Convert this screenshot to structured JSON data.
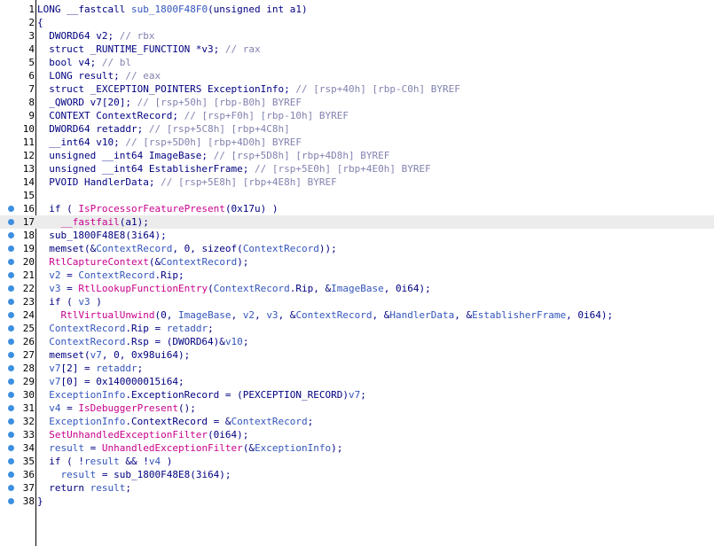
{
  "colors": {
    "background": "#ffffff",
    "keyword_text": "#000080",
    "api_call": "#c8008c",
    "variable": "#3355bb",
    "comment": "#8282b0",
    "line_number": "#000000",
    "breakpoint_dot": "#3d8fe0",
    "current_line_highlight": "#ececec"
  },
  "code_lines": [
    {
      "num": "1",
      "bp": false,
      "hl": false,
      "parts": [
        [
          "",
          "LONG __fastcall "
        ],
        [
          "uf",
          "sub_1800F48F0"
        ],
        [
          "",
          "(unsigned int a1)"
        ]
      ]
    },
    {
      "num": "2",
      "bp": false,
      "hl": false,
      "parts": [
        [
          "",
          "{"
        ]
      ]
    },
    {
      "num": "3",
      "bp": false,
      "hl": false,
      "parts": [
        [
          "",
          "  DWORD64 v2; "
        ],
        [
          "cmt",
          "// rbx"
        ]
      ]
    },
    {
      "num": "4",
      "bp": false,
      "hl": false,
      "parts": [
        [
          "",
          "  struct _RUNTIME_FUNCTION *v3; "
        ],
        [
          "cmt",
          "// rax"
        ]
      ]
    },
    {
      "num": "5",
      "bp": false,
      "hl": false,
      "parts": [
        [
          "",
          "  bool v4; "
        ],
        [
          "cmt",
          "// bl"
        ]
      ]
    },
    {
      "num": "6",
      "bp": false,
      "hl": false,
      "parts": [
        [
          "",
          "  LONG result; "
        ],
        [
          "cmt",
          "// eax"
        ]
      ]
    },
    {
      "num": "7",
      "bp": false,
      "hl": false,
      "parts": [
        [
          "",
          "  struct _EXCEPTION_POINTERS ExceptionInfo; "
        ],
        [
          "cmt",
          "// [rsp+40h] [rbp-C0h] BYREF"
        ]
      ]
    },
    {
      "num": "8",
      "bp": false,
      "hl": false,
      "parts": [
        [
          "",
          "  _QWORD v7[20]; "
        ],
        [
          "cmt",
          "// [rsp+50h] [rbp-B0h] BYREF"
        ]
      ]
    },
    {
      "num": "9",
      "bp": false,
      "hl": false,
      "parts": [
        [
          "",
          "  CONTEXT ContextRecord; "
        ],
        [
          "cmt",
          "// [rsp+F0h] [rbp-10h] BYREF"
        ]
      ]
    },
    {
      "num": "10",
      "bp": false,
      "hl": false,
      "parts": [
        [
          "",
          "  DWORD64 retaddr; "
        ],
        [
          "cmt",
          "// [rsp+5C8h] [rbp+4C8h]"
        ]
      ]
    },
    {
      "num": "11",
      "bp": false,
      "hl": false,
      "parts": [
        [
          "",
          "  __int64 v10; "
        ],
        [
          "cmt",
          "// [rsp+5D0h] [rbp+4D0h] BYREF"
        ]
      ]
    },
    {
      "num": "12",
      "bp": false,
      "hl": false,
      "parts": [
        [
          "",
          "  unsigned __int64 ImageBase; "
        ],
        [
          "cmt",
          "// [rsp+5D8h] [rbp+4D8h] BYREF"
        ]
      ]
    },
    {
      "num": "13",
      "bp": false,
      "hl": false,
      "parts": [
        [
          "",
          "  unsigned __int64 EstablisherFrame; "
        ],
        [
          "cmt",
          "// [rsp+5E0h] [rbp+4E0h] BYREF"
        ]
      ]
    },
    {
      "num": "14",
      "bp": false,
      "hl": false,
      "parts": [
        [
          "",
          "  PVOID HandlerData; "
        ],
        [
          "cmt",
          "// [rsp+5E8h] [rbp+4E8h] BYREF"
        ]
      ]
    },
    {
      "num": "15",
      "bp": false,
      "hl": false,
      "parts": [
        [
          "",
          ""
        ]
      ]
    },
    {
      "num": "16",
      "bp": true,
      "hl": false,
      "parts": [
        [
          "",
          "  if ( "
        ],
        [
          "api",
          "IsProcessorFeaturePresent"
        ],
        [
          "",
          "(0x17u) )"
        ]
      ]
    },
    {
      "num": "17",
      "bp": true,
      "hl": true,
      "parts": [
        [
          "",
          "    "
        ],
        [
          "api",
          "__fastfail"
        ],
        [
          "",
          "(a1);"
        ]
      ]
    },
    {
      "num": "18",
      "bp": true,
      "hl": false,
      "parts": [
        [
          "",
          "  sub_1800F48E8(3i64);"
        ]
      ]
    },
    {
      "num": "19",
      "bp": true,
      "hl": false,
      "parts": [
        [
          "",
          "  memset(&"
        ],
        [
          "var",
          "ContextRecord"
        ],
        [
          "",
          ", 0, sizeof("
        ],
        [
          "var",
          "ContextRecord"
        ],
        [
          "",
          "));"
        ]
      ]
    },
    {
      "num": "20",
      "bp": true,
      "hl": false,
      "parts": [
        [
          "api",
          "  RtlCaptureContext"
        ],
        [
          "",
          "(&"
        ],
        [
          "var",
          "ContextRecord"
        ],
        [
          "",
          ");"
        ]
      ]
    },
    {
      "num": "21",
      "bp": true,
      "hl": false,
      "parts": [
        [
          "var",
          "  v2"
        ],
        [
          "",
          " = "
        ],
        [
          "var",
          "ContextRecord"
        ],
        [
          "",
          ".Rip;"
        ]
      ]
    },
    {
      "num": "22",
      "bp": true,
      "hl": false,
      "parts": [
        [
          "var",
          "  v3"
        ],
        [
          "",
          " = "
        ],
        [
          "api",
          "RtlLookupFunctionEntry"
        ],
        [
          "",
          "("
        ],
        [
          "var",
          "ContextRecord"
        ],
        [
          "",
          ".Rip, &"
        ],
        [
          "var",
          "ImageBase"
        ],
        [
          "",
          ", 0i64);"
        ]
      ]
    },
    {
      "num": "23",
      "bp": true,
      "hl": false,
      "parts": [
        [
          "",
          "  if ( "
        ],
        [
          "var",
          "v3"
        ],
        [
          "",
          " )"
        ]
      ]
    },
    {
      "num": "24",
      "bp": true,
      "hl": false,
      "parts": [
        [
          "api",
          "    RtlVirtualUnwind"
        ],
        [
          "",
          "(0, "
        ],
        [
          "var",
          "ImageBase"
        ],
        [
          "",
          ", "
        ],
        [
          "var",
          "v2"
        ],
        [
          "",
          ", "
        ],
        [
          "var",
          "v3"
        ],
        [
          "",
          ", &"
        ],
        [
          "var",
          "ContextRecord"
        ],
        [
          "",
          ", &"
        ],
        [
          "var",
          "HandlerData"
        ],
        [
          "",
          ", &"
        ],
        [
          "var",
          "EstablisherFrame"
        ],
        [
          "",
          ", 0i64);"
        ]
      ]
    },
    {
      "num": "25",
      "bp": true,
      "hl": false,
      "parts": [
        [
          "var",
          "  ContextRecord"
        ],
        [
          "",
          ".Rip = "
        ],
        [
          "var",
          "retaddr"
        ],
        [
          "",
          ";"
        ]
      ]
    },
    {
      "num": "26",
      "bp": true,
      "hl": false,
      "parts": [
        [
          "var",
          "  ContextRecord"
        ],
        [
          "",
          ".Rsp = (DWORD64)&"
        ],
        [
          "var",
          "v10"
        ],
        [
          "",
          ";"
        ]
      ]
    },
    {
      "num": "27",
      "bp": true,
      "hl": false,
      "parts": [
        [
          "",
          "  memset("
        ],
        [
          "var",
          "v7"
        ],
        [
          "",
          ", 0, 0x98ui64);"
        ]
      ]
    },
    {
      "num": "28",
      "bp": true,
      "hl": false,
      "parts": [
        [
          "var",
          "  v7"
        ],
        [
          "",
          "[2] = "
        ],
        [
          "var",
          "retaddr"
        ],
        [
          "",
          ";"
        ]
      ]
    },
    {
      "num": "29",
      "bp": true,
      "hl": false,
      "parts": [
        [
          "var",
          "  v7"
        ],
        [
          "",
          "[0] = 0x140000015i64;"
        ]
      ]
    },
    {
      "num": "30",
      "bp": true,
      "hl": false,
      "parts": [
        [
          "var",
          "  ExceptionInfo"
        ],
        [
          "",
          ".ExceptionRecord = (PEXCEPTION_RECORD)"
        ],
        [
          "var",
          "v7"
        ],
        [
          "",
          ";"
        ]
      ]
    },
    {
      "num": "31",
      "bp": true,
      "hl": false,
      "parts": [
        [
          "var",
          "  v4"
        ],
        [
          "",
          " = "
        ],
        [
          "api",
          "IsDebuggerPresent"
        ],
        [
          "",
          "();"
        ]
      ]
    },
    {
      "num": "32",
      "bp": true,
      "hl": false,
      "parts": [
        [
          "var",
          "  ExceptionInfo"
        ],
        [
          "",
          ".ContextRecord = &"
        ],
        [
          "var",
          "ContextRecord"
        ],
        [
          "",
          ";"
        ]
      ]
    },
    {
      "num": "33",
      "bp": true,
      "hl": false,
      "parts": [
        [
          "api",
          "  SetUnhandledExceptionFilter"
        ],
        [
          "",
          "(0i64);"
        ]
      ]
    },
    {
      "num": "34",
      "bp": true,
      "hl": false,
      "parts": [
        [
          "var",
          "  result"
        ],
        [
          "",
          " = "
        ],
        [
          "api",
          "UnhandledExceptionFilter"
        ],
        [
          "",
          "(&"
        ],
        [
          "var",
          "ExceptionInfo"
        ],
        [
          "",
          ");"
        ]
      ]
    },
    {
      "num": "35",
      "bp": true,
      "hl": false,
      "parts": [
        [
          "",
          "  if ( !"
        ],
        [
          "var",
          "result"
        ],
        [
          "",
          " && !"
        ],
        [
          "var",
          "v4"
        ],
        [
          "",
          " )"
        ]
      ]
    },
    {
      "num": "36",
      "bp": true,
      "hl": false,
      "parts": [
        [
          "var",
          "    result"
        ],
        [
          "",
          " = sub_1800F48E8(3i64);"
        ]
      ]
    },
    {
      "num": "37",
      "bp": true,
      "hl": false,
      "parts": [
        [
          "",
          "  return "
        ],
        [
          "var",
          "result"
        ],
        [
          "",
          ";"
        ]
      ]
    },
    {
      "num": "38",
      "bp": true,
      "hl": false,
      "parts": [
        [
          "",
          "}"
        ]
      ]
    }
  ]
}
